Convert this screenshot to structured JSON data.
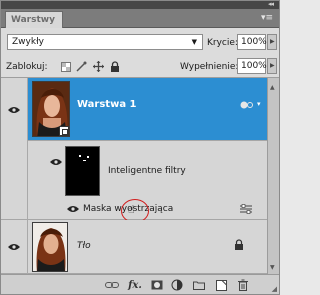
{
  "panel": {
    "tab_label": "Warstwy",
    "collapse_glyph": "◂◂",
    "menu_glyph": "▾≡"
  },
  "blend": {
    "mode_value": "Zwykły",
    "opacity_label": "Krycie:",
    "opacity_value": "100%"
  },
  "lock": {
    "label": "Zablokuj:",
    "fill_label": "Wypełnienie:",
    "fill_value": "100%"
  },
  "layers": [
    {
      "name": "Warstwa 1",
      "selected": true,
      "visible": true,
      "type": "smart-object"
    },
    {
      "name": "Inteligentne filtry",
      "type": "smart-filters",
      "visible": true
    },
    {
      "name": "Maska wyostrzająca",
      "type": "filter",
      "visible": true
    },
    {
      "name": "Tło",
      "type": "background",
      "visible": true,
      "locked": true
    }
  ],
  "colors": {
    "selection": "#2c8ed2",
    "panel_bg": "#d6d6d6",
    "cursor_ring": "#d11e1e"
  },
  "toolbar": {
    "icons": [
      "link-icon",
      "fx-icon",
      "mask-icon",
      "adjustment-icon",
      "group-icon",
      "new-layer-icon",
      "trash-icon"
    ],
    "fx_label": "fx."
  }
}
